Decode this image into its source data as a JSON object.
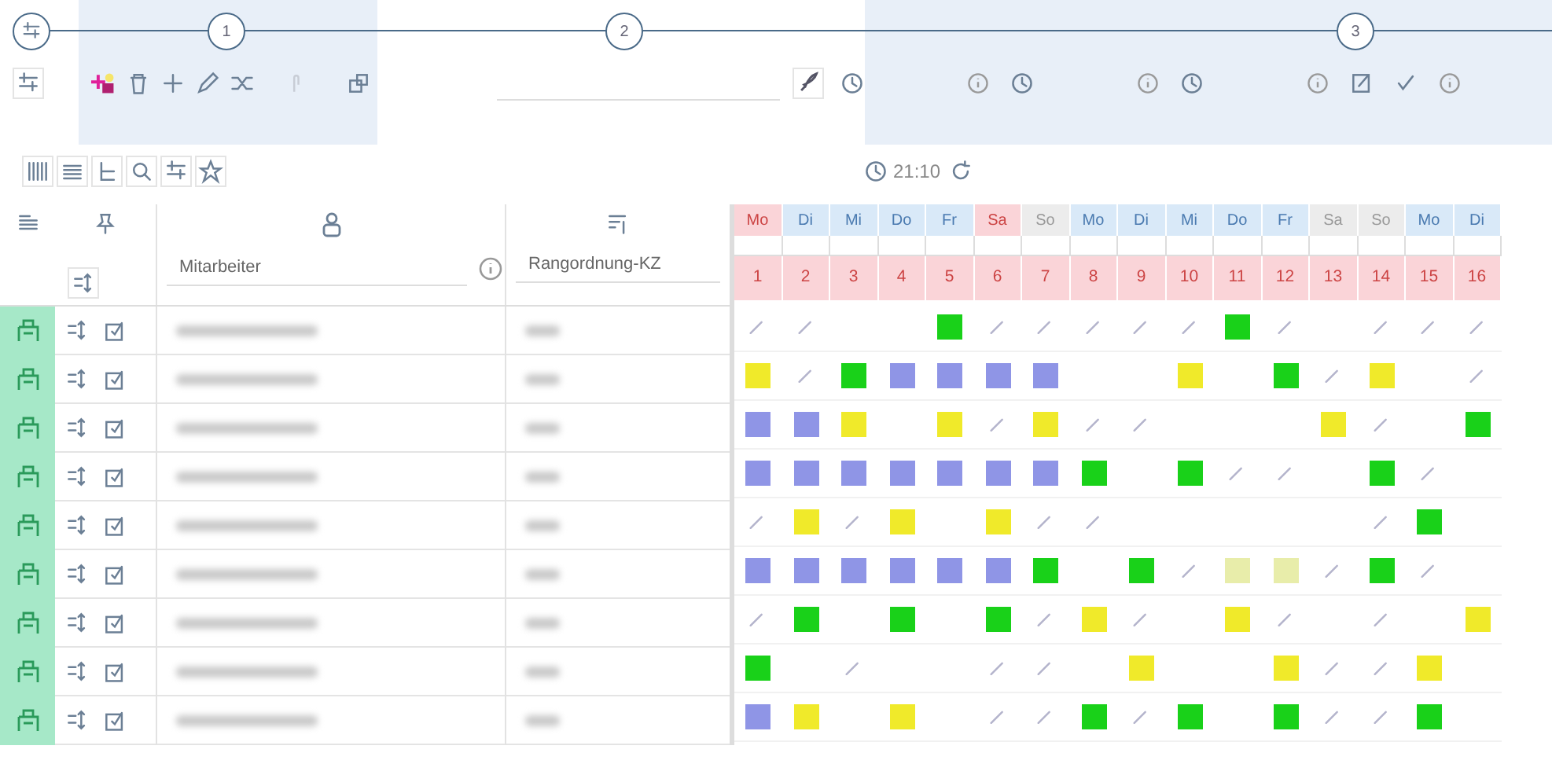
{
  "stepper": {
    "steps": [
      {
        "label": "1"
      },
      {
        "label": "2"
      },
      {
        "label": "3"
      }
    ]
  },
  "clock": {
    "time": "21:10"
  },
  "table": {
    "columns": [
      "Mitarbeiter",
      "Rangordnung-KZ"
    ],
    "days": [
      {
        "label": "Mo",
        "number": "1",
        "kind": "holiday"
      },
      {
        "label": "Di",
        "number": "2",
        "kind": "workday"
      },
      {
        "label": "Mi",
        "number": "3",
        "kind": "workday"
      },
      {
        "label": "Do",
        "number": "4",
        "kind": "workday"
      },
      {
        "label": "Fr",
        "number": "5",
        "kind": "workday"
      },
      {
        "label": "Sa",
        "number": "6",
        "kind": "holiday"
      },
      {
        "label": "So",
        "number": "7",
        "kind": "weekend"
      },
      {
        "label": "Mo",
        "number": "8",
        "kind": "workday"
      },
      {
        "label": "Di",
        "number": "9",
        "kind": "workday"
      },
      {
        "label": "Mi",
        "number": "10",
        "kind": "workday"
      },
      {
        "label": "Do",
        "number": "11",
        "kind": "workday"
      },
      {
        "label": "Fr",
        "number": "12",
        "kind": "workday"
      },
      {
        "label": "Sa",
        "number": "13",
        "kind": "weekend"
      },
      {
        "label": "So",
        "number": "14",
        "kind": "weekend"
      },
      {
        "label": "Mo",
        "number": "15",
        "kind": "workday"
      },
      {
        "label": "Di",
        "number": "16",
        "kind": "workday"
      }
    ],
    "rows": [
      {
        "cells": [
          {
            "kind": "faint"
          },
          {
            "kind": "faint"
          },
          {
            "kind": "empty"
          },
          {
            "kind": "empty"
          },
          {
            "kind": "green"
          },
          {
            "kind": "faint"
          },
          {
            "kind": "faint"
          },
          {
            "kind": "faint"
          },
          {
            "kind": "faint"
          },
          {
            "kind": "faint"
          },
          {
            "kind": "green"
          },
          {
            "kind": "faint"
          },
          {
            "kind": "empty"
          },
          {
            "kind": "faint"
          },
          {
            "kind": "faint"
          },
          {
            "kind": "faint"
          }
        ]
      },
      {
        "cells": [
          {
            "kind": "yellow"
          },
          {
            "kind": "faint"
          },
          {
            "kind": "green"
          },
          {
            "kind": "blue"
          },
          {
            "kind": "blue"
          },
          {
            "kind": "blue"
          },
          {
            "kind": "blue"
          },
          {
            "kind": "empty"
          },
          {
            "kind": "empty"
          },
          {
            "kind": "yellow"
          },
          {
            "kind": "empty"
          },
          {
            "kind": "green"
          },
          {
            "kind": "faint"
          },
          {
            "kind": "yellow"
          },
          {
            "kind": "empty"
          },
          {
            "kind": "faint"
          }
        ]
      },
      {
        "cells": [
          {
            "kind": "blue"
          },
          {
            "kind": "blue"
          },
          {
            "kind": "yellow"
          },
          {
            "kind": "empty"
          },
          {
            "kind": "yellow"
          },
          {
            "kind": "faint"
          },
          {
            "kind": "yellow"
          },
          {
            "kind": "faint"
          },
          {
            "kind": "faint"
          },
          {
            "kind": "empty"
          },
          {
            "kind": "empty"
          },
          {
            "kind": "empty"
          },
          {
            "kind": "yellow"
          },
          {
            "kind": "faint"
          },
          {
            "kind": "empty"
          },
          {
            "kind": "green"
          }
        ]
      },
      {
        "cells": [
          {
            "kind": "blue"
          },
          {
            "kind": "blue"
          },
          {
            "kind": "blue"
          },
          {
            "kind": "blue"
          },
          {
            "kind": "blue"
          },
          {
            "kind": "blue"
          },
          {
            "kind": "blue"
          },
          {
            "kind": "green"
          },
          {
            "kind": "empty"
          },
          {
            "kind": "green"
          },
          {
            "kind": "faint"
          },
          {
            "kind": "faint"
          },
          {
            "kind": "empty"
          },
          {
            "kind": "green"
          },
          {
            "kind": "faint"
          },
          {
            "kind": "empty"
          }
        ]
      },
      {
        "cells": [
          {
            "kind": "faint"
          },
          {
            "kind": "yellow"
          },
          {
            "kind": "faint"
          },
          {
            "kind": "yellow"
          },
          {
            "kind": "empty"
          },
          {
            "kind": "yellow"
          },
          {
            "kind": "faint"
          },
          {
            "kind": "faint"
          },
          {
            "kind": "empty"
          },
          {
            "kind": "empty"
          },
          {
            "kind": "empty"
          },
          {
            "kind": "empty"
          },
          {
            "kind": "empty"
          },
          {
            "kind": "faint"
          },
          {
            "kind": "green"
          },
          {
            "kind": "empty"
          }
        ]
      },
      {
        "cells": [
          {
            "kind": "blue"
          },
          {
            "kind": "blue"
          },
          {
            "kind": "blue"
          },
          {
            "kind": "blue"
          },
          {
            "kind": "blue"
          },
          {
            "kind": "blue"
          },
          {
            "kind": "green"
          },
          {
            "kind": "empty"
          },
          {
            "kind": "green"
          },
          {
            "kind": "faint"
          },
          {
            "kind": "pale"
          },
          {
            "kind": "pale"
          },
          {
            "kind": "faint"
          },
          {
            "kind": "green"
          },
          {
            "kind": "faint"
          },
          {
            "kind": "empty"
          }
        ]
      },
      {
        "cells": [
          {
            "kind": "faint"
          },
          {
            "kind": "green"
          },
          {
            "kind": "empty"
          },
          {
            "kind": "green"
          },
          {
            "kind": "empty"
          },
          {
            "kind": "green"
          },
          {
            "kind": "faint"
          },
          {
            "kind": "yellow"
          },
          {
            "kind": "faint"
          },
          {
            "kind": "empty"
          },
          {
            "kind": "yellow"
          },
          {
            "kind": "faint"
          },
          {
            "kind": "empty"
          },
          {
            "kind": "faint"
          },
          {
            "kind": "empty"
          },
          {
            "kind": "yellow"
          }
        ]
      },
      {
        "cells": [
          {
            "kind": "green"
          },
          {
            "kind": "empty"
          },
          {
            "kind": "faint"
          },
          {
            "kind": "empty"
          },
          {
            "kind": "empty"
          },
          {
            "kind": "faint"
          },
          {
            "kind": "faint"
          },
          {
            "kind": "empty"
          },
          {
            "kind": "yellow"
          },
          {
            "kind": "empty"
          },
          {
            "kind": "empty"
          },
          {
            "kind": "yellow"
          },
          {
            "kind": "faint"
          },
          {
            "kind": "faint"
          },
          {
            "kind": "yellow"
          },
          {
            "kind": "empty"
          }
        ]
      },
      {
        "cells": [
          {
            "kind": "blue"
          },
          {
            "kind": "yellow"
          },
          {
            "kind": "empty"
          },
          {
            "kind": "yellow"
          },
          {
            "kind": "empty"
          },
          {
            "kind": "faint"
          },
          {
            "kind": "faint"
          },
          {
            "kind": "green"
          },
          {
            "kind": "faint"
          },
          {
            "kind": "green"
          },
          {
            "kind": "empty"
          },
          {
            "kind": "green"
          },
          {
            "kind": "faint"
          },
          {
            "kind": "faint"
          },
          {
            "kind": "green"
          },
          {
            "kind": "empty"
          }
        ]
      }
    ]
  }
}
